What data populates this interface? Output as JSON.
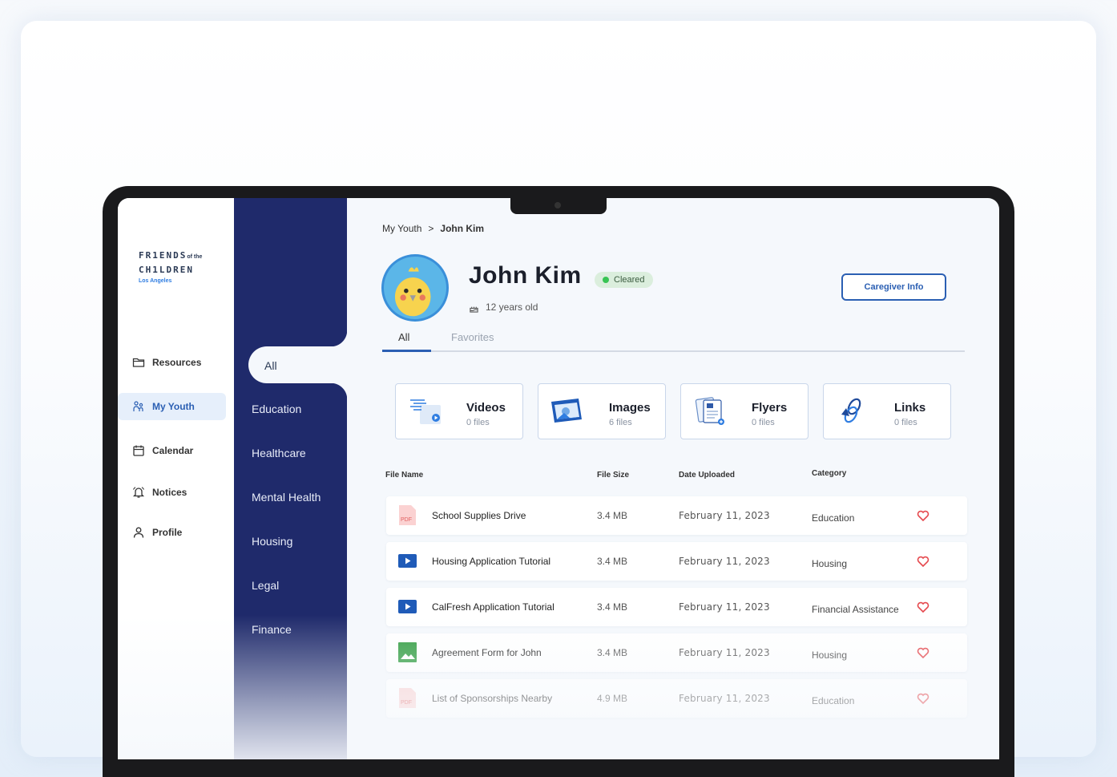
{
  "logo": {
    "line1": "FR1ENDS",
    "of_the": "of the",
    "line2": "CH1LDREN",
    "line3": "Los Angeles"
  },
  "nav": [
    {
      "label": "Resources",
      "icon": "folder-icon"
    },
    {
      "label": "My Youth",
      "icon": "people-icon",
      "active": true
    },
    {
      "label": "Calendar",
      "icon": "calendar-icon"
    },
    {
      "label": "Notices",
      "icon": "bell-icon"
    },
    {
      "label": "Profile",
      "icon": "person-icon"
    }
  ],
  "categories": [
    "All",
    "Education",
    "Healthcare",
    "Mental Health",
    "Housing",
    "Legal",
    "Finance"
  ],
  "breadcrumb": {
    "parent": "My Youth",
    "separator": ">",
    "current": "John Kim"
  },
  "profile": {
    "name": "John Kim",
    "status": "Cleared",
    "age": "12 years old",
    "status_color": "#38c454"
  },
  "caregiver_button": "Caregiver Info",
  "tabs": {
    "all": "All",
    "favorites": "Favorites"
  },
  "tiles": [
    {
      "title": "Videos",
      "count": "0 files",
      "icon": "video-icon"
    },
    {
      "title": "Images",
      "count": "6 files",
      "icon": "image-icon"
    },
    {
      "title": "Flyers",
      "count": "0 files",
      "icon": "flyer-icon"
    },
    {
      "title": "Links",
      "count": "0 files",
      "icon": "link-icon"
    }
  ],
  "table": {
    "headers": {
      "name": "File Name",
      "size": "File Size",
      "date": "Date Uploaded",
      "category": "Category"
    },
    "rows": [
      {
        "type": "pdf",
        "name": "School Supplies Drive",
        "size": "3.4 MB",
        "date": "February 11, 2023",
        "category": "Education"
      },
      {
        "type": "video",
        "name": "Housing Application Tutorial",
        "size": "3.4 MB",
        "date": "February 11, 2023",
        "category": "Housing"
      },
      {
        "type": "video",
        "name": "CalFresh Application Tutorial",
        "size": "3.4 MB",
        "date": "February 11, 2023",
        "category": "Financial Assistance"
      },
      {
        "type": "image",
        "name": "Agreement Form for John",
        "size": "3.4 MB",
        "date": "February 11, 2023",
        "category": "Housing"
      },
      {
        "type": "pdf",
        "name": "List of Sponsorships Nearby",
        "size": "4.9 MB",
        "date": "February 11, 2023",
        "category": "Education"
      }
    ]
  },
  "colors": {
    "navy": "#1f2a6b",
    "accent": "#2b5fb3",
    "heart": "#e5484d"
  }
}
